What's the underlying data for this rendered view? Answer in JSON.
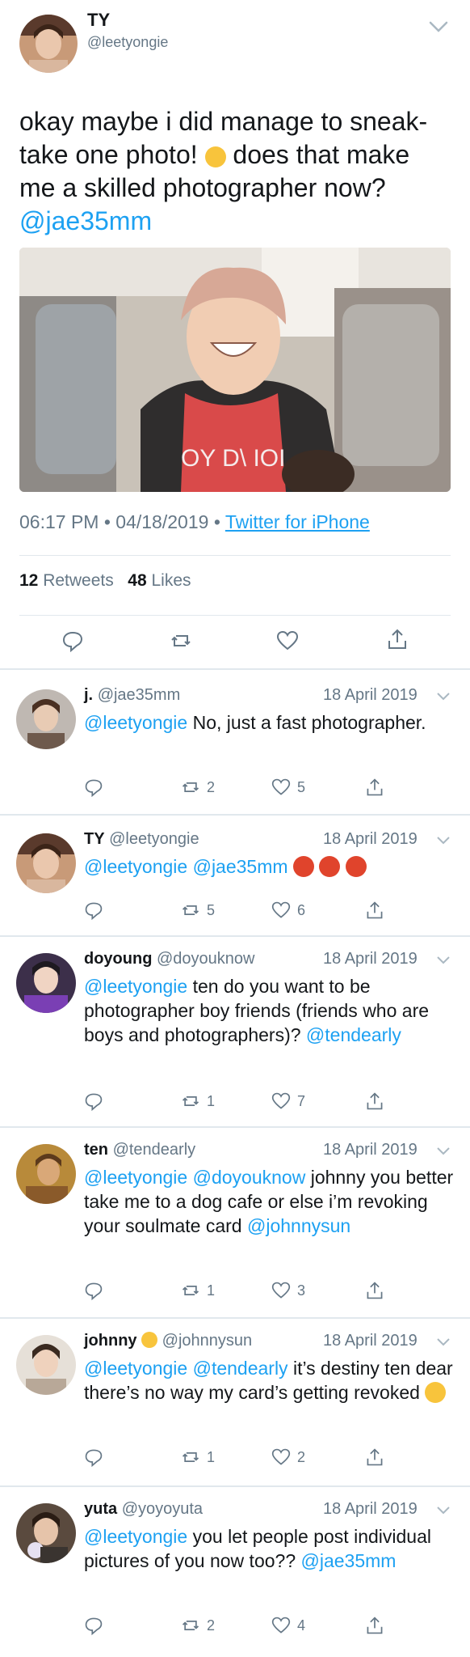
{
  "main_tweet": {
    "name": "TY",
    "handle": "@leetyongie",
    "text_line1": "okay maybe i did manage to sneak-",
    "text_line2a": "take one photo! ",
    "text_line2b": " does that make",
    "text_line3": "me a skilled photographer now?",
    "text_mention": "@jae35mm",
    "time": "06:17 PM",
    "date": "04/18/2019",
    "dot": "•",
    "client": "Twitter for iPhone",
    "retweets_count": "12",
    "retweets_label": "Retweets",
    "likes_count": "48",
    "likes_label": "Likes",
    "photo_shirt_text": "OY D\\ IOI"
  },
  "icons": {
    "reply": "reply-icon",
    "retweet": "retweet-icon",
    "like": "heart-icon",
    "share": "share-icon",
    "more": "chevron-down-icon"
  },
  "colors": {
    "link": "#1da1f2",
    "secondary": "#657786",
    "divider": "#e1e8ed"
  },
  "replies": [
    {
      "name": "j.",
      "handle": "@jae35mm",
      "date": "18 April 2019",
      "mention": "@leetyongie",
      "text": " No, just a fast photographer.",
      "retweets": "2",
      "likes": "5"
    },
    {
      "name": "TY",
      "handle": "@leetyongie",
      "date": "18 April 2019",
      "mention": "@leetyongie @jae35mm",
      "text": "",
      "retweets": "5",
      "likes": "6"
    },
    {
      "name": "doyoung",
      "handle": "@doyouknow",
      "date": "18 April 2019",
      "mention": "@leetyongie",
      "text": " ten do you want to be photographer boy friends (friends who are boys and photographers)?",
      "mention_end": "@tendearly",
      "retweets": "1",
      "likes": "7"
    },
    {
      "name": "ten",
      "handle": "@tendearly",
      "date": "18 April 2019",
      "mention": "@leetyongie @doyouknow",
      "text": " johnny you better take me to a dog cafe or else i’m revoking your soulmate card",
      "mention_end": "@johnnysun",
      "retweets": "1",
      "likes": "3"
    },
    {
      "name": "johnny",
      "handle": "@johnnysun",
      "date": "18 April 2019",
      "mention": "@leetyongie @tendearly",
      "text": " it’s destiny ten dear there’s no way my card’s getting revoked",
      "retweets": "1",
      "likes": "2"
    },
    {
      "name": "yuta",
      "handle": "@yoyoyuta",
      "date": "18 April 2019",
      "mention": "@leetyongie",
      "text": " you let people post individual pictures of you now too??",
      "mention_end": "@jae35mm",
      "retweets": "2",
      "likes": "4"
    }
  ]
}
